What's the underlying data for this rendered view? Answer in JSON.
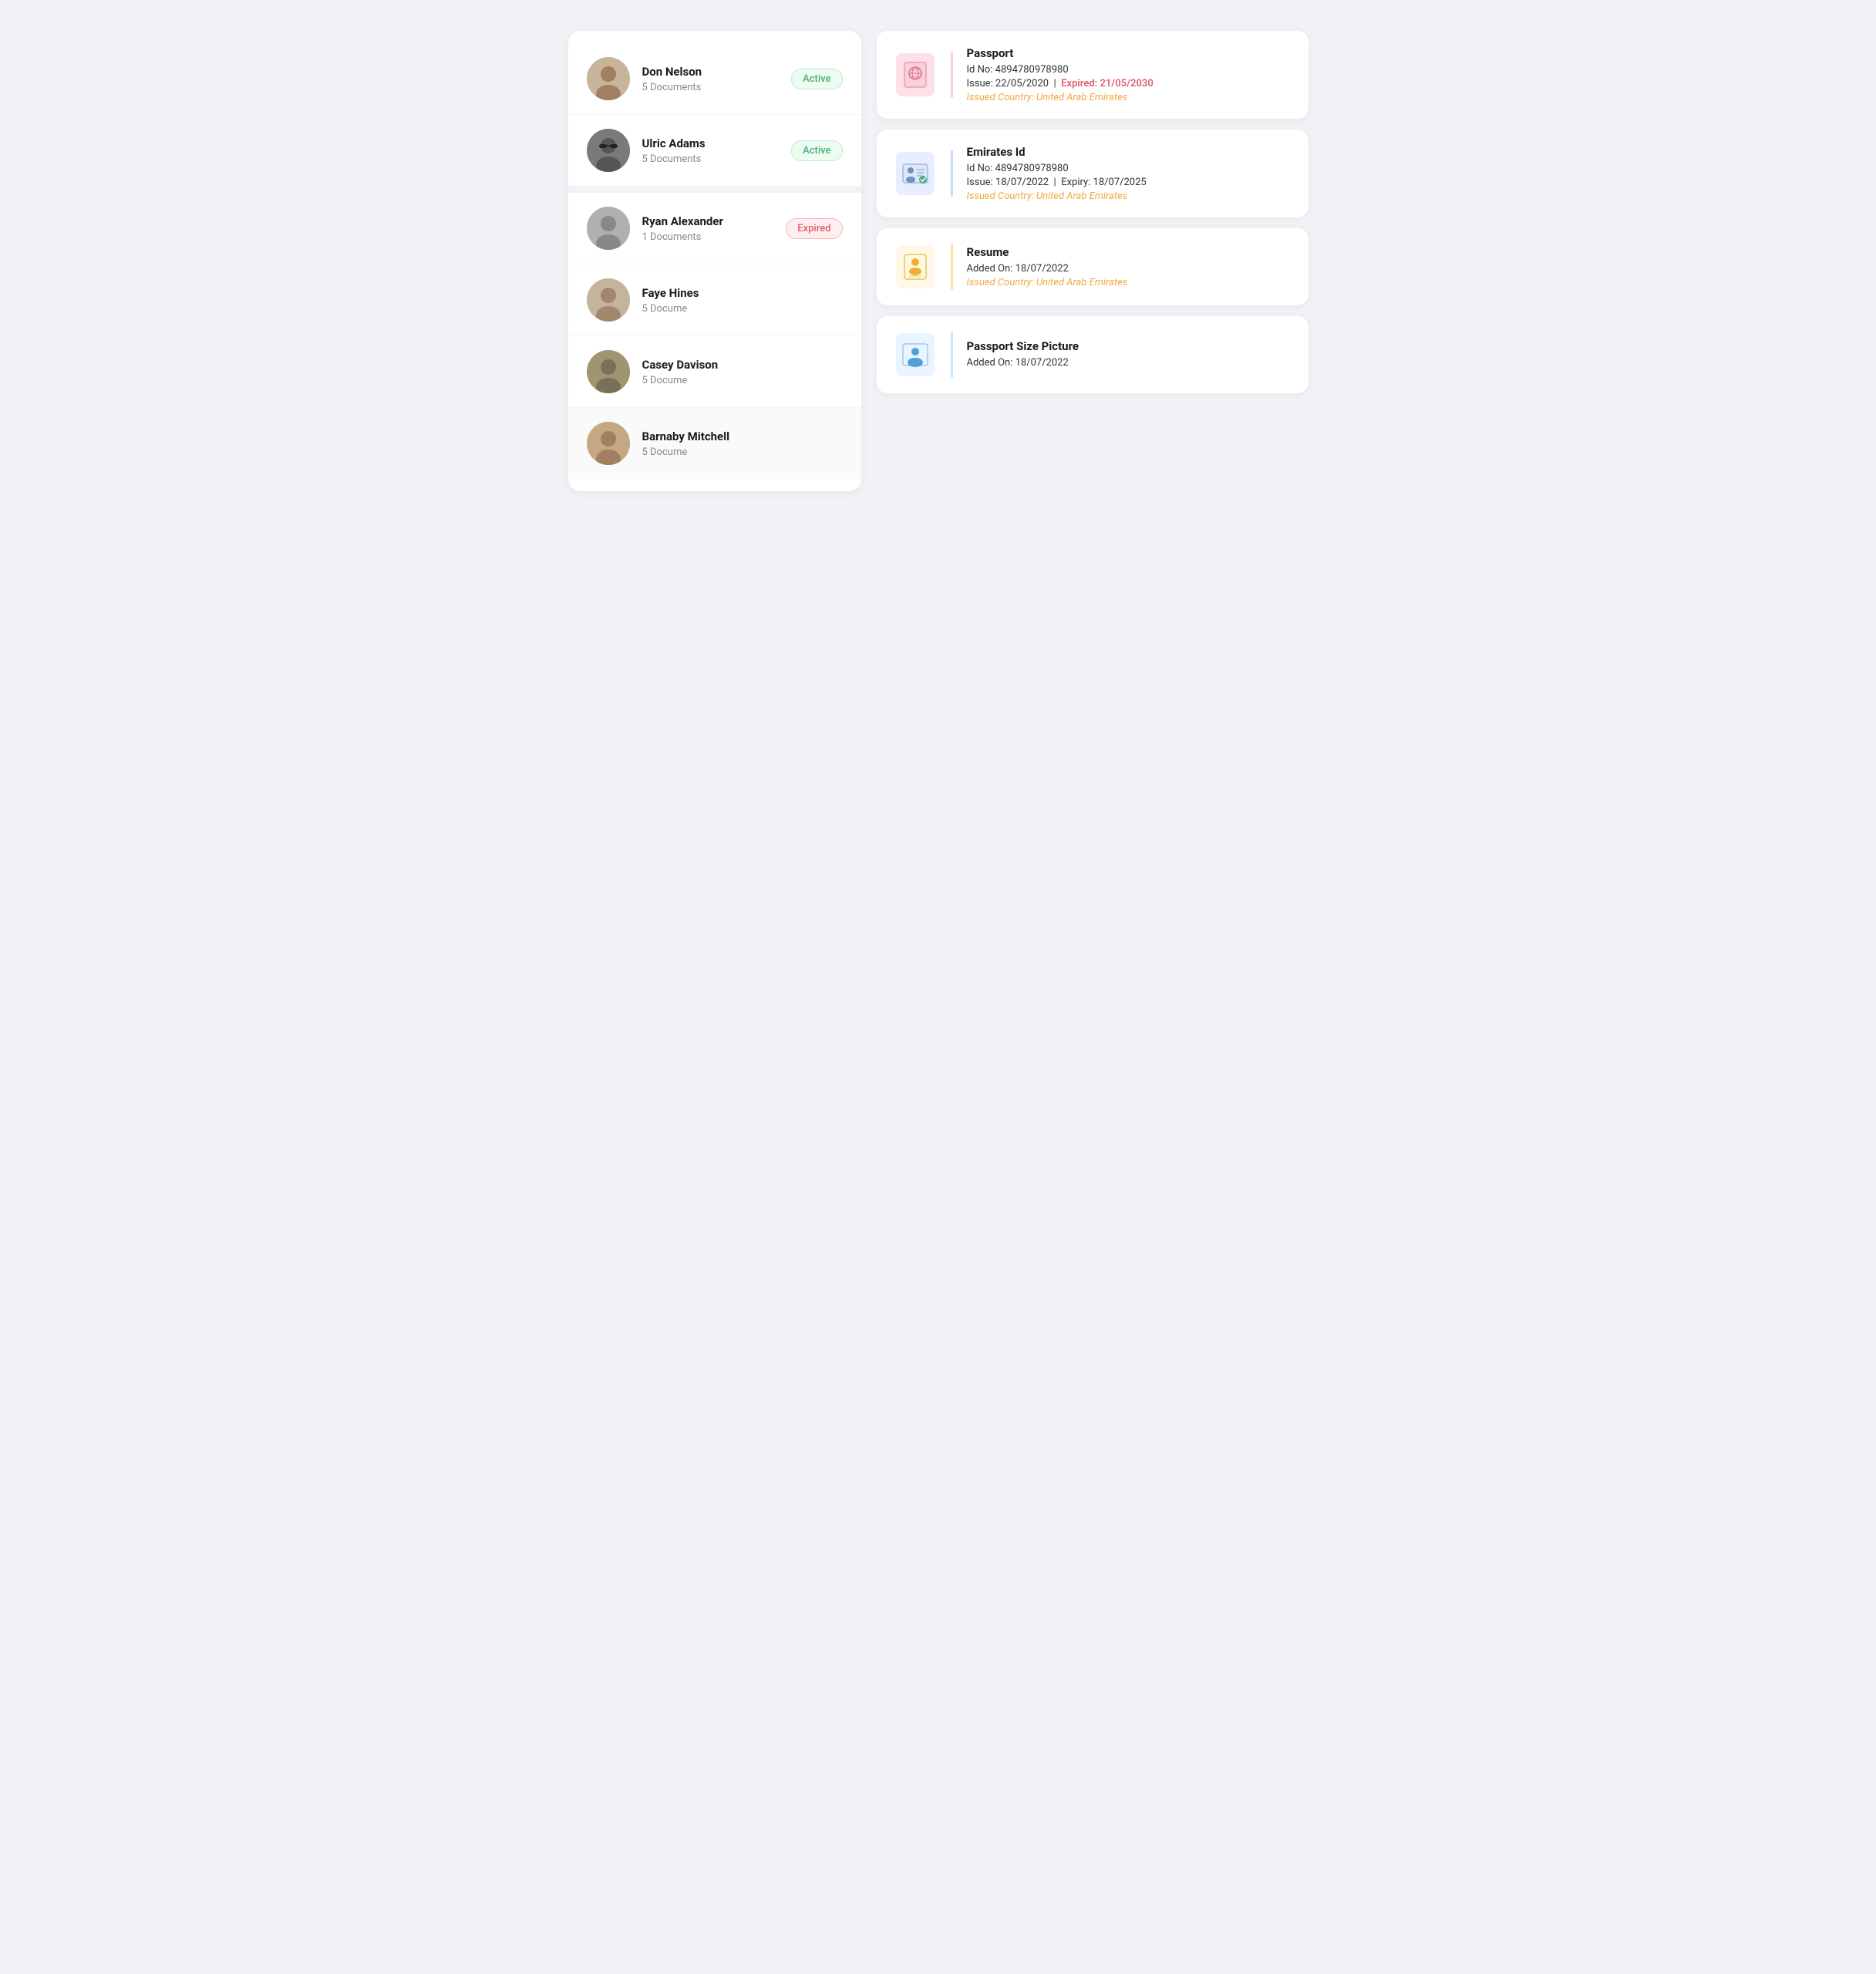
{
  "persons": [
    {
      "id": "don-nelson",
      "name": "Don Nelson",
      "doc_count": "5 Documents",
      "status": "Active",
      "status_type": "active",
      "avatar_color": "#c8b49a"
    },
    {
      "id": "ulric-adams",
      "name": "Ulric Adams",
      "doc_count": "5 Documents",
      "status": "Active",
      "status_type": "active",
      "avatar_color": "#7a7a7a"
    },
    {
      "id": "ryan-alexander",
      "name": "Ryan Alexander",
      "doc_count": "1 Documents",
      "status": "Expired",
      "status_type": "expired",
      "avatar_color": "#b0b0b0"
    },
    {
      "id": "faye-hines",
      "name": "Faye Hines",
      "doc_count": "5 Docume",
      "status": "",
      "status_type": "none",
      "avatar_color": "#c4b49e"
    },
    {
      "id": "casey-davison",
      "name": "Casey Davison",
      "doc_count": "5 Docume",
      "status": "",
      "status_type": "none",
      "avatar_color": "#a0956e"
    },
    {
      "id": "barnaby-mitchell",
      "name": "Barnaby Mitchell",
      "doc_count": "5 Docume",
      "status": "",
      "status_type": "none",
      "avatar_color": "#c4a882",
      "selected": true
    }
  ],
  "documents": [
    {
      "id": "passport",
      "title": "Passport",
      "id_label": "Id No:",
      "id_value": "4894780978980",
      "has_dates": true,
      "issue_label": "Issue:",
      "issue_value": "22/05/2020",
      "expiry_label": "Expired:",
      "expiry_value": "21/05/2030",
      "expiry_style": "expired",
      "country_label": "Issued Country: United Arab Emirates",
      "icon_type": "passport",
      "divider_class": "doc-divider-passport"
    },
    {
      "id": "emirates-id",
      "title": "Emirates Id",
      "id_label": "Id No:",
      "id_value": "4894780978980",
      "has_dates": true,
      "issue_label": "Issue:",
      "issue_value": "18/07/2022",
      "expiry_label": "Expiry:",
      "expiry_value": "18/07/2025",
      "expiry_style": "normal",
      "country_label": "Issued Country: United Arab Emirates",
      "icon_type": "emiratesid",
      "divider_class": "doc-divider-emiratesid"
    },
    {
      "id": "resume",
      "title": "Resume",
      "id_label": "",
      "id_value": "",
      "has_dates": false,
      "added_label": "Added On:",
      "added_value": "18/07/2022",
      "country_label": "Issued Country: United Arab Emirates",
      "icon_type": "resume",
      "divider_class": "doc-divider-resume"
    },
    {
      "id": "passport-size-picture",
      "title": "Passport Size Picture",
      "id_label": "",
      "id_value": "",
      "has_dates": false,
      "added_label": "Added On:",
      "added_value": "18/07/2022",
      "country_label": "",
      "icon_type": "picture",
      "divider_class": "doc-divider-picture"
    }
  ]
}
